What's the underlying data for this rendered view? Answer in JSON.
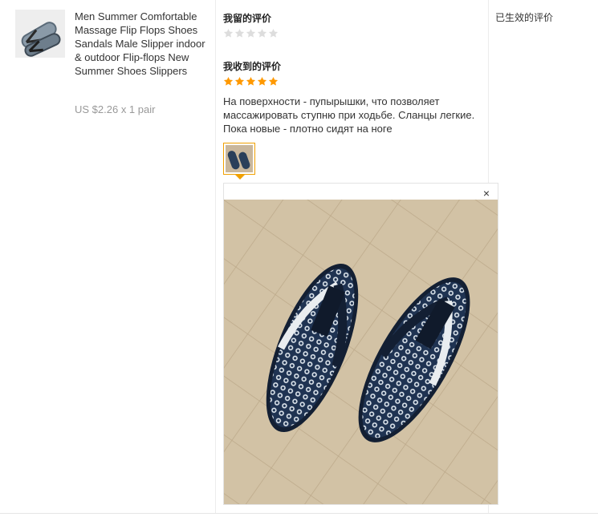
{
  "product": {
    "title": "Men Summer Comfortable Massage Flip Flops Shoes Sandals Male Slipper indoor & outdoor Flip-flops New Summer Shoes Slippers",
    "price": "US $2.26 x 1 pair",
    "thumbnail_icon": "flip-flops-thumbnail"
  },
  "my_review": {
    "heading": "我留的评价",
    "rating": 0,
    "max": 5
  },
  "received_review": {
    "heading": "我收到的评价",
    "rating": 5,
    "max": 5,
    "text": "На поверхности - пупырышки, что позволяет массажировать ступню при ходьбе. Сланцы легкие. Пока новые - плотно сидят на ноге",
    "photo_icon": "flip-flops-photo"
  },
  "viewer": {
    "close_label": "×"
  },
  "effective_reviews": {
    "heading": "已生效的评价"
  },
  "colors": {
    "star_on": "#ff9900",
    "star_off": "#dddddd",
    "thumb_border": "#f0a000"
  }
}
